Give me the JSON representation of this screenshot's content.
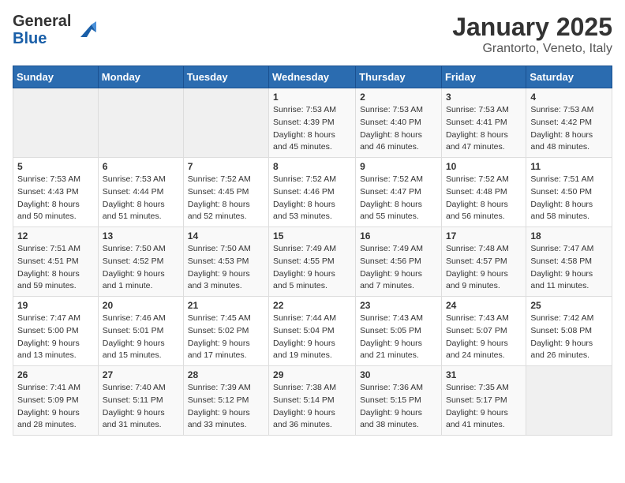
{
  "header": {
    "logo_general": "General",
    "logo_blue": "Blue",
    "month": "January 2025",
    "location": "Grantorto, Veneto, Italy"
  },
  "weekdays": [
    "Sunday",
    "Monday",
    "Tuesday",
    "Wednesday",
    "Thursday",
    "Friday",
    "Saturday"
  ],
  "weeks": [
    [
      {
        "day": "",
        "sunrise": "",
        "sunset": "",
        "daylight": ""
      },
      {
        "day": "",
        "sunrise": "",
        "sunset": "",
        "daylight": ""
      },
      {
        "day": "",
        "sunrise": "",
        "sunset": "",
        "daylight": ""
      },
      {
        "day": "1",
        "sunrise": "Sunrise: 7:53 AM",
        "sunset": "Sunset: 4:39 PM",
        "daylight": "Daylight: 8 hours and 45 minutes."
      },
      {
        "day": "2",
        "sunrise": "Sunrise: 7:53 AM",
        "sunset": "Sunset: 4:40 PM",
        "daylight": "Daylight: 8 hours and 46 minutes."
      },
      {
        "day": "3",
        "sunrise": "Sunrise: 7:53 AM",
        "sunset": "Sunset: 4:41 PM",
        "daylight": "Daylight: 8 hours and 47 minutes."
      },
      {
        "day": "4",
        "sunrise": "Sunrise: 7:53 AM",
        "sunset": "Sunset: 4:42 PM",
        "daylight": "Daylight: 8 hours and 48 minutes."
      }
    ],
    [
      {
        "day": "5",
        "sunrise": "Sunrise: 7:53 AM",
        "sunset": "Sunset: 4:43 PM",
        "daylight": "Daylight: 8 hours and 50 minutes."
      },
      {
        "day": "6",
        "sunrise": "Sunrise: 7:53 AM",
        "sunset": "Sunset: 4:44 PM",
        "daylight": "Daylight: 8 hours and 51 minutes."
      },
      {
        "day": "7",
        "sunrise": "Sunrise: 7:52 AM",
        "sunset": "Sunset: 4:45 PM",
        "daylight": "Daylight: 8 hours and 52 minutes."
      },
      {
        "day": "8",
        "sunrise": "Sunrise: 7:52 AM",
        "sunset": "Sunset: 4:46 PM",
        "daylight": "Daylight: 8 hours and 53 minutes."
      },
      {
        "day": "9",
        "sunrise": "Sunrise: 7:52 AM",
        "sunset": "Sunset: 4:47 PM",
        "daylight": "Daylight: 8 hours and 55 minutes."
      },
      {
        "day": "10",
        "sunrise": "Sunrise: 7:52 AM",
        "sunset": "Sunset: 4:48 PM",
        "daylight": "Daylight: 8 hours and 56 minutes."
      },
      {
        "day": "11",
        "sunrise": "Sunrise: 7:51 AM",
        "sunset": "Sunset: 4:50 PM",
        "daylight": "Daylight: 8 hours and 58 minutes."
      }
    ],
    [
      {
        "day": "12",
        "sunrise": "Sunrise: 7:51 AM",
        "sunset": "Sunset: 4:51 PM",
        "daylight": "Daylight: 8 hours and 59 minutes."
      },
      {
        "day": "13",
        "sunrise": "Sunrise: 7:50 AM",
        "sunset": "Sunset: 4:52 PM",
        "daylight": "Daylight: 9 hours and 1 minute."
      },
      {
        "day": "14",
        "sunrise": "Sunrise: 7:50 AM",
        "sunset": "Sunset: 4:53 PM",
        "daylight": "Daylight: 9 hours and 3 minutes."
      },
      {
        "day": "15",
        "sunrise": "Sunrise: 7:49 AM",
        "sunset": "Sunset: 4:55 PM",
        "daylight": "Daylight: 9 hours and 5 minutes."
      },
      {
        "day": "16",
        "sunrise": "Sunrise: 7:49 AM",
        "sunset": "Sunset: 4:56 PM",
        "daylight": "Daylight: 9 hours and 7 minutes."
      },
      {
        "day": "17",
        "sunrise": "Sunrise: 7:48 AM",
        "sunset": "Sunset: 4:57 PM",
        "daylight": "Daylight: 9 hours and 9 minutes."
      },
      {
        "day": "18",
        "sunrise": "Sunrise: 7:47 AM",
        "sunset": "Sunset: 4:58 PM",
        "daylight": "Daylight: 9 hours and 11 minutes."
      }
    ],
    [
      {
        "day": "19",
        "sunrise": "Sunrise: 7:47 AM",
        "sunset": "Sunset: 5:00 PM",
        "daylight": "Daylight: 9 hours and 13 minutes."
      },
      {
        "day": "20",
        "sunrise": "Sunrise: 7:46 AM",
        "sunset": "Sunset: 5:01 PM",
        "daylight": "Daylight: 9 hours and 15 minutes."
      },
      {
        "day": "21",
        "sunrise": "Sunrise: 7:45 AM",
        "sunset": "Sunset: 5:02 PM",
        "daylight": "Daylight: 9 hours and 17 minutes."
      },
      {
        "day": "22",
        "sunrise": "Sunrise: 7:44 AM",
        "sunset": "Sunset: 5:04 PM",
        "daylight": "Daylight: 9 hours and 19 minutes."
      },
      {
        "day": "23",
        "sunrise": "Sunrise: 7:43 AM",
        "sunset": "Sunset: 5:05 PM",
        "daylight": "Daylight: 9 hours and 21 minutes."
      },
      {
        "day": "24",
        "sunrise": "Sunrise: 7:43 AM",
        "sunset": "Sunset: 5:07 PM",
        "daylight": "Daylight: 9 hours and 24 minutes."
      },
      {
        "day": "25",
        "sunrise": "Sunrise: 7:42 AM",
        "sunset": "Sunset: 5:08 PM",
        "daylight": "Daylight: 9 hours and 26 minutes."
      }
    ],
    [
      {
        "day": "26",
        "sunrise": "Sunrise: 7:41 AM",
        "sunset": "Sunset: 5:09 PM",
        "daylight": "Daylight: 9 hours and 28 minutes."
      },
      {
        "day": "27",
        "sunrise": "Sunrise: 7:40 AM",
        "sunset": "Sunset: 5:11 PM",
        "daylight": "Daylight: 9 hours and 31 minutes."
      },
      {
        "day": "28",
        "sunrise": "Sunrise: 7:39 AM",
        "sunset": "Sunset: 5:12 PM",
        "daylight": "Daylight: 9 hours and 33 minutes."
      },
      {
        "day": "29",
        "sunrise": "Sunrise: 7:38 AM",
        "sunset": "Sunset: 5:14 PM",
        "daylight": "Daylight: 9 hours and 36 minutes."
      },
      {
        "day": "30",
        "sunrise": "Sunrise: 7:36 AM",
        "sunset": "Sunset: 5:15 PM",
        "daylight": "Daylight: 9 hours and 38 minutes."
      },
      {
        "day": "31",
        "sunrise": "Sunrise: 7:35 AM",
        "sunset": "Sunset: 5:17 PM",
        "daylight": "Daylight: 9 hours and 41 minutes."
      },
      {
        "day": "",
        "sunrise": "",
        "sunset": "",
        "daylight": ""
      }
    ]
  ]
}
